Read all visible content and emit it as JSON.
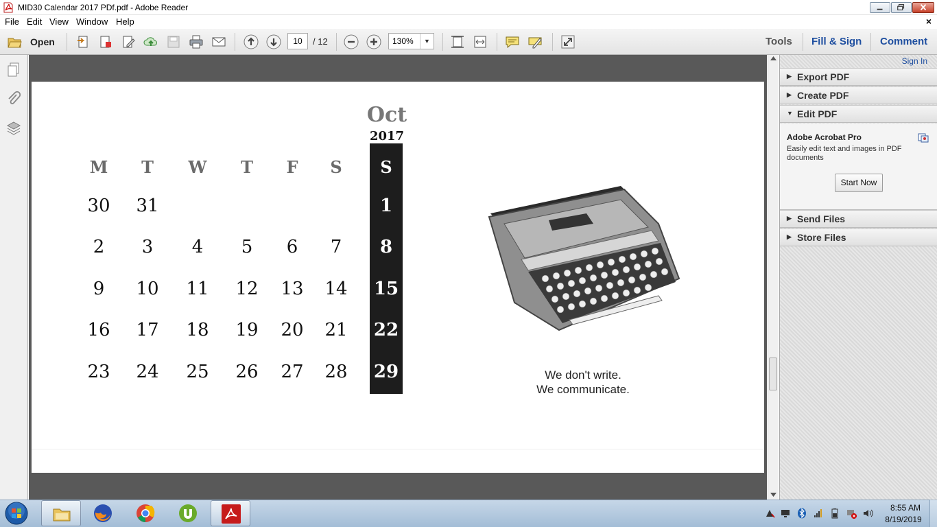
{
  "window": {
    "title": "MID30 Calendar 2017 PDf.pdf - Adobe Reader"
  },
  "menu": {
    "items": [
      "File",
      "Edit",
      "View",
      "Window",
      "Help"
    ],
    "close_glyph": "×"
  },
  "toolbar": {
    "open_label": "Open",
    "page_current": "10",
    "page_total": "/ 12",
    "zoom": "130%",
    "tabs": [
      "Tools",
      "Fill & Sign",
      "Comment"
    ]
  },
  "right_pane": {
    "sign_in": "Sign In",
    "panels": [
      {
        "label": "Export PDF",
        "arrow": "▶"
      },
      {
        "label": "Create PDF",
        "arrow": "▶"
      },
      {
        "label": "Edit PDF",
        "arrow": "▼"
      },
      {
        "label": "Send Files",
        "arrow": "▶"
      },
      {
        "label": "Store Files",
        "arrow": "▶"
      }
    ],
    "acrobat_title": "Adobe Acrobat Pro",
    "acrobat_desc": "Easily edit text and images in PDF documents",
    "start_now": "Start Now"
  },
  "calendar": {
    "month": "Oct",
    "year": "2017",
    "day_headers": [
      "M",
      "T",
      "W",
      "T",
      "F",
      "S",
      "S"
    ],
    "rows": [
      [
        "30",
        "31",
        "",
        "",
        "",
        "",
        "1"
      ],
      [
        "2",
        "3",
        "4",
        "5",
        "6",
        "7",
        "8"
      ],
      [
        "9",
        "10",
        "11",
        "12",
        "13",
        "14",
        "15"
      ],
      [
        "16",
        "17",
        "18",
        "19",
        "20",
        "21",
        "22"
      ],
      [
        "23",
        "24",
        "25",
        "26",
        "27",
        "28",
        "29"
      ]
    ],
    "tagline_1": "We don't write.",
    "tagline_2": "We communicate."
  },
  "taskbar": {
    "time": "8:55 AM",
    "date": "8/19/2019"
  },
  "colors": {
    "accent_blue": "#1f4fa0",
    "sunday_column": "#1d1d1d",
    "doc_background": "#595959"
  }
}
